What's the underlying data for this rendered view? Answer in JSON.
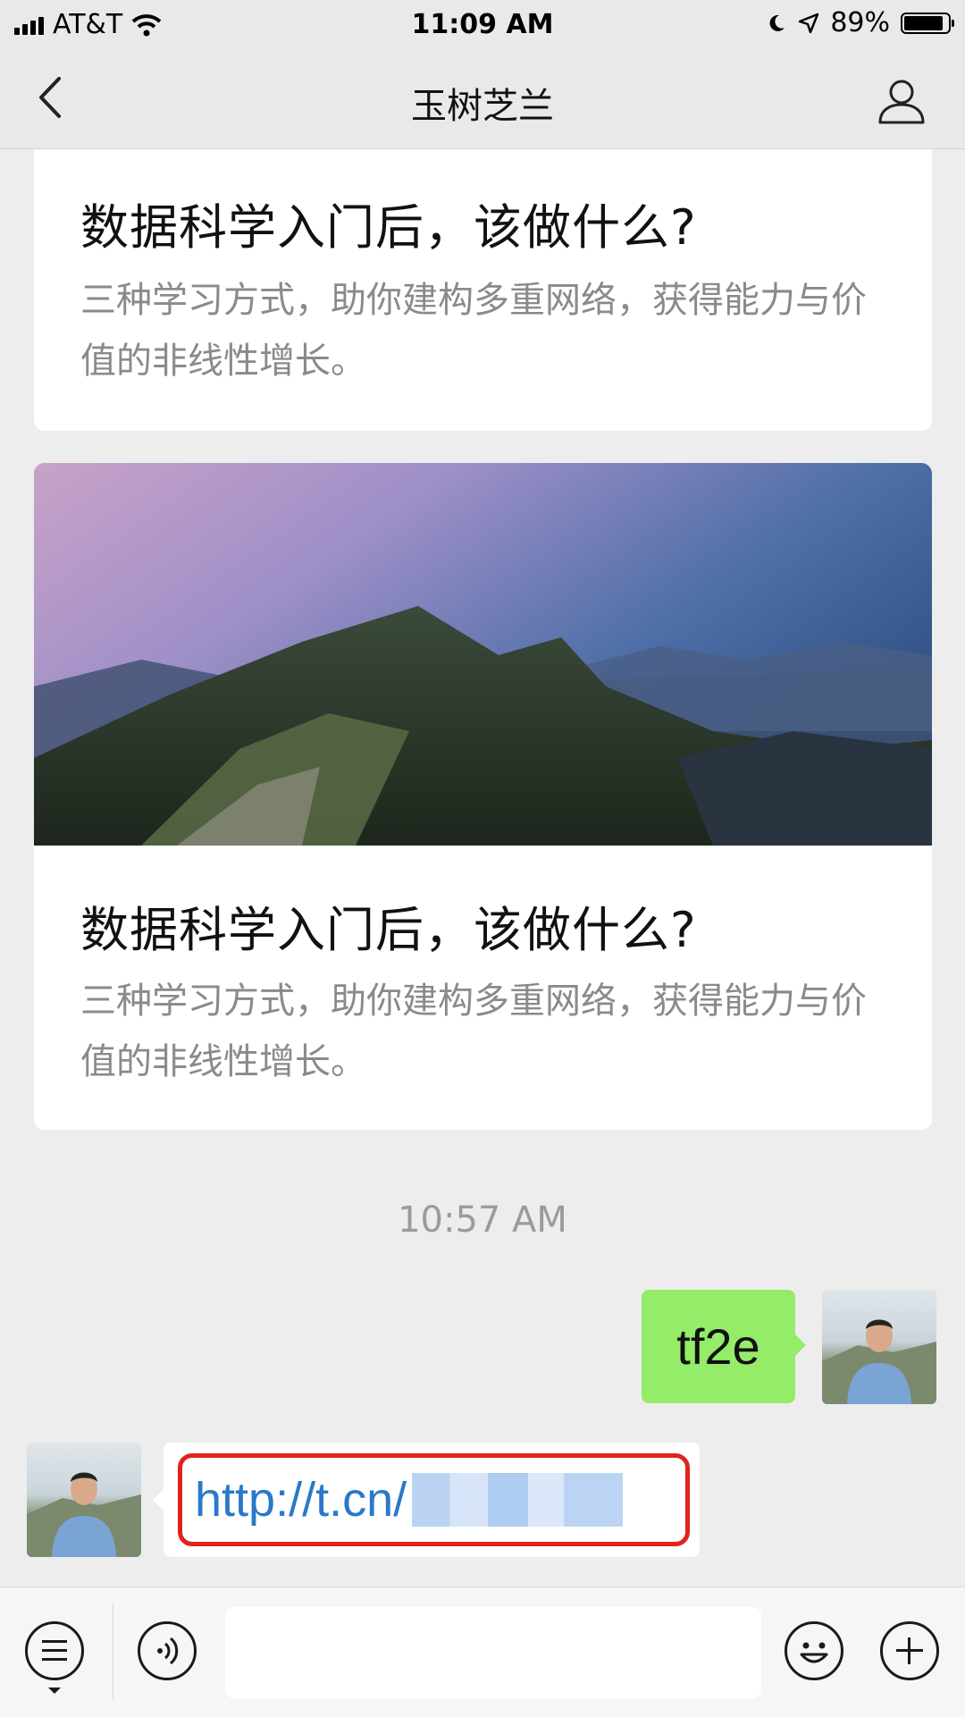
{
  "status_bar": {
    "carrier": "AT&T",
    "time": "11:09 AM",
    "battery_text": "89%",
    "battery_level": 0.89
  },
  "nav": {
    "title": "玉树芝兰",
    "back_icon": "chevron-left-icon",
    "profile_icon": "person-icon"
  },
  "cards": [
    {
      "title": "数据科学入门后，该做什么?",
      "description": "三种学习方式，助你建构多重网络，获得能力与价值的非线性增长。"
    },
    {
      "image": "mountain-ridge-at-dusk",
      "title": "数据科学入门后，该做什么?",
      "description": "三种学习方式，助你建构多重网络，获得能力与价值的非线性增长。"
    }
  ],
  "timestamp": "10:57 AM",
  "messages": [
    {
      "sender": "me",
      "text": "tf2e"
    },
    {
      "sender": "other",
      "link_text": "http://t.cn/",
      "redacted": true
    }
  ],
  "input_bar": {
    "menu_icon": "list-menu-icon",
    "voice_icon": "voice-icon",
    "emoji_icon": "emoji-icon",
    "plus_icon": "plus-icon",
    "message_placeholder": ""
  },
  "colors": {
    "sent_bubble": "#95ec69",
    "link": "#2a78c9",
    "highlight_box": "#e0231d",
    "chat_background": "#ededed"
  }
}
